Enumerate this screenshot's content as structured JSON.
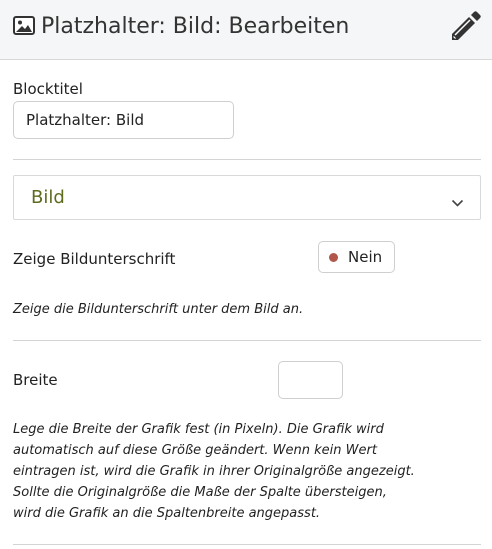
{
  "header": {
    "title": "Platzhalter: Bild: Bearbeiten",
    "image_icon": "image-icon",
    "edit_icon": "pencil-icon"
  },
  "block_title": {
    "label": "Blocktitel",
    "value": "Platzhalter: Bild"
  },
  "section": {
    "label": "Bild",
    "expand_icon": "chevron-down-icon",
    "label_color": "#5e6b1f"
  },
  "caption": {
    "label": "Zeige Bildunterschrift",
    "toggle_state": "Nein",
    "toggle_dot_color": "#b0564a",
    "help": "Zeige die Bildunterschrift unter dem Bild an."
  },
  "width": {
    "label": "Breite",
    "value": "",
    "help_lines": [
      "Lege die Breite der Grafik fest (in Pixeln). Die Grafik wird",
      "automatisch auf diese Größe geändert. Wenn kein Wert",
      "eintragen ist, wird die Grafik in ihrer Originalgröße angezeigt.",
      "Sollte die Originalgröße die Maße der Spalte übersteigen,",
      "wird die Grafik an die Spaltenbreite angepasst."
    ]
  }
}
